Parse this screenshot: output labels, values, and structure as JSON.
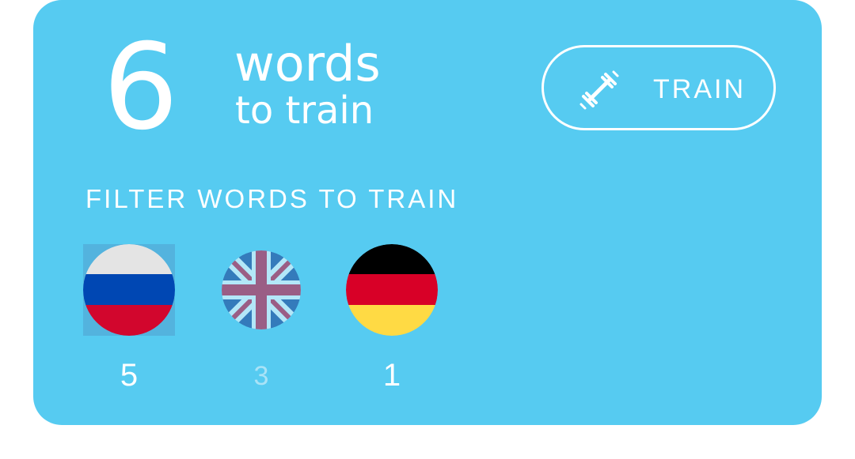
{
  "summary": {
    "count": "6",
    "words_label": "words",
    "to_train_label": "to train"
  },
  "train_button": {
    "label": "TRAIN",
    "icon": "dumbbell-icon"
  },
  "filter": {
    "heading": "FILTER WORDS TO TRAIN",
    "languages": [
      {
        "flag": "russia-flag-icon",
        "count": "5",
        "selected": true
      },
      {
        "flag": "uk-flag-icon",
        "count": "3",
        "selected": false
      },
      {
        "flag": "germany-flag-icon",
        "count": "1",
        "selected": false
      }
    ]
  },
  "colors": {
    "card_background": "#56cbf1",
    "text": "#ffffff",
    "dim_text": "#a9e3f7"
  }
}
